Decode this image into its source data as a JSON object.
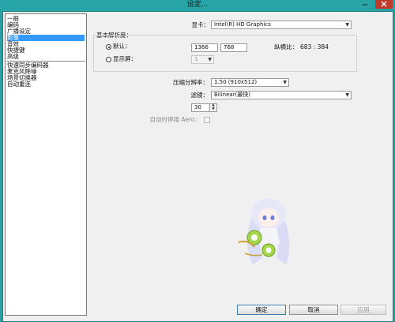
{
  "window": {
    "title": "设定..."
  },
  "sidebar": {
    "items": [
      "一般",
      "编码",
      "广播设定",
      "影像",
      "音效",
      "快捷键",
      "高级",
      "快速同步编码器",
      "麦克风降噪",
      "场景切换器",
      "自动重连"
    ],
    "selected_index": 3
  },
  "video": {
    "adapter_label": "显卡：",
    "adapter_value": "Intel(R) HD Graphics",
    "base_resolution_title": "基本解析度：",
    "default_label": "默认：",
    "width_value": "1366",
    "height_value": "768",
    "aspect_label": "纵横比：",
    "aspect_value": "683 : 384",
    "monitor_label": "显示屏：",
    "monitor_value": "1",
    "downscale_label": "压缩分辨率：",
    "downscale_value": "1.50 (910x512)",
    "filter_label": "滤镜：",
    "filter_value": "Bilinear(最快)",
    "fps_label": "FPS：",
    "fps_value": "30",
    "aero_label": "自动时停用 Aero："
  },
  "buttons": {
    "ok": "确定",
    "cancel": "取消",
    "apply": "应用"
  },
  "colors": {
    "accent": "#3399ff",
    "window_frame": "#27a4a6",
    "close_button": "#c0392b"
  }
}
